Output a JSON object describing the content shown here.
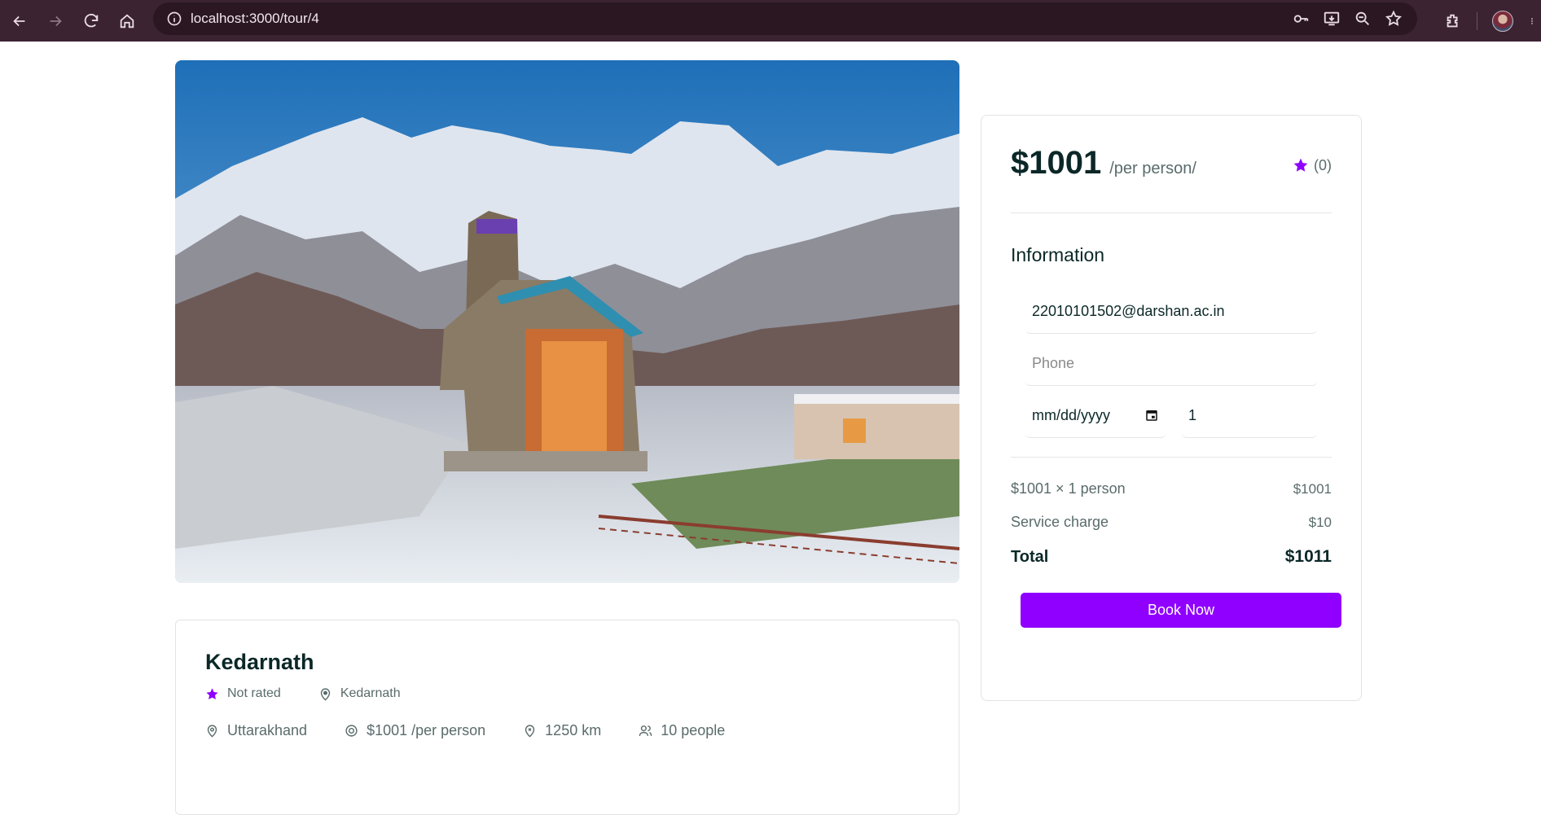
{
  "browser": {
    "url": "localhost:3000/tour/4",
    "back_icon": "arrow-left-icon",
    "forward_icon": "arrow-right-icon",
    "reload_icon": "reload-icon",
    "home_icon": "home-icon"
  },
  "tour": {
    "title": "Kedarnath",
    "rating_text": "Not rated",
    "city": "Kedarnath",
    "state": "Uttarakhand",
    "price_text": "$1001 /per person",
    "distance": "1250 km",
    "group_size": "10 people"
  },
  "booking": {
    "price": "$1001",
    "per_label": "/per person/",
    "rating_count": "(0)",
    "info_title": "Information",
    "email_value": "22010101502@darshan.ac.in",
    "phone_placeholder": "Phone",
    "date_placeholder": "mm/dd/yyyy",
    "guests_value": "1",
    "line_item_label": "$1001 × 1 person",
    "line_item_value": "$1001",
    "service_label": "Service charge",
    "service_value": "$10",
    "total_label": "Total",
    "total_value": "$1011",
    "book_label": "Book Now"
  },
  "colors": {
    "accent": "#8f00ff",
    "heading": "#0b2727",
    "chrome": "#3b2332"
  }
}
